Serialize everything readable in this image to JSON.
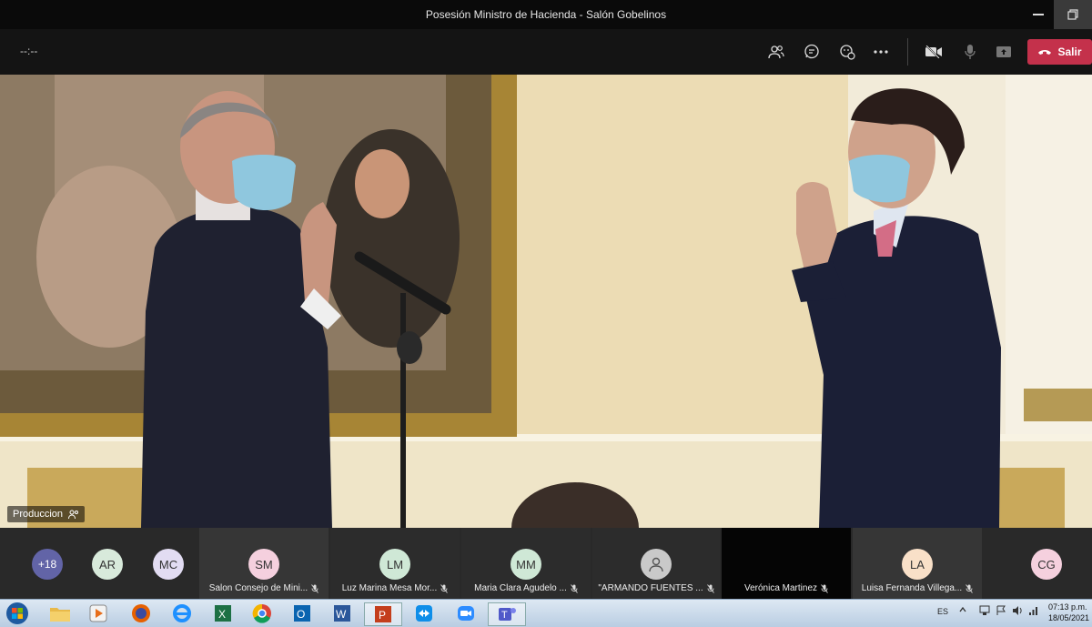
{
  "window": {
    "title": "Posesión Ministro de Hacienda - Salón Gobelinos"
  },
  "toolbar": {
    "timer": "--:--",
    "leave_label": "Salir",
    "icons": [
      "people-icon",
      "chat-icon",
      "reactions-icon",
      "more-icon",
      "camera-off-icon",
      "mic-off-icon",
      "share-icon"
    ]
  },
  "video": {
    "name_label": "Produccion"
  },
  "participants": {
    "overflow_count": "+18",
    "tiles": [
      {
        "initials": "AR",
        "name": "",
        "color": "#d8eadb"
      },
      {
        "initials": "MC",
        "name": "",
        "color": "#e2dcf2"
      },
      {
        "initials": "SM",
        "name": "Salon Consejo de Mini...",
        "color": "#f5d0de"
      },
      {
        "initials": "LM",
        "name": "Luz Marina Mesa Mor...",
        "color": "#cfe8d6"
      },
      {
        "initials": "MM",
        "name": "Maria Clara Agudelo ...",
        "color": "#cfe8d6"
      },
      {
        "initials": "",
        "name": "\"ARMANDO FUENTES ...",
        "color": "#c9c9c9"
      },
      {
        "initials": "",
        "name": "Verónica Martinez",
        "color": ""
      },
      {
        "initials": "LA",
        "name": "Luisa Fernanda Villega...",
        "color": "#f9e0c8"
      },
      {
        "initials": "CG",
        "name": "",
        "color": "#f5d0de"
      }
    ]
  },
  "taskbar": {
    "apps": [
      "explorer-icon",
      "media-player-icon",
      "firefox-icon",
      "internet-explorer-icon",
      "excel-icon",
      "chrome-icon",
      "outlook-icon",
      "word-icon",
      "powerpoint-icon",
      "teamviewer-icon",
      "zoom-icon",
      "teams-icon"
    ],
    "language": "ES",
    "time": "07:13 p.m.",
    "date": "18/05/2021"
  }
}
